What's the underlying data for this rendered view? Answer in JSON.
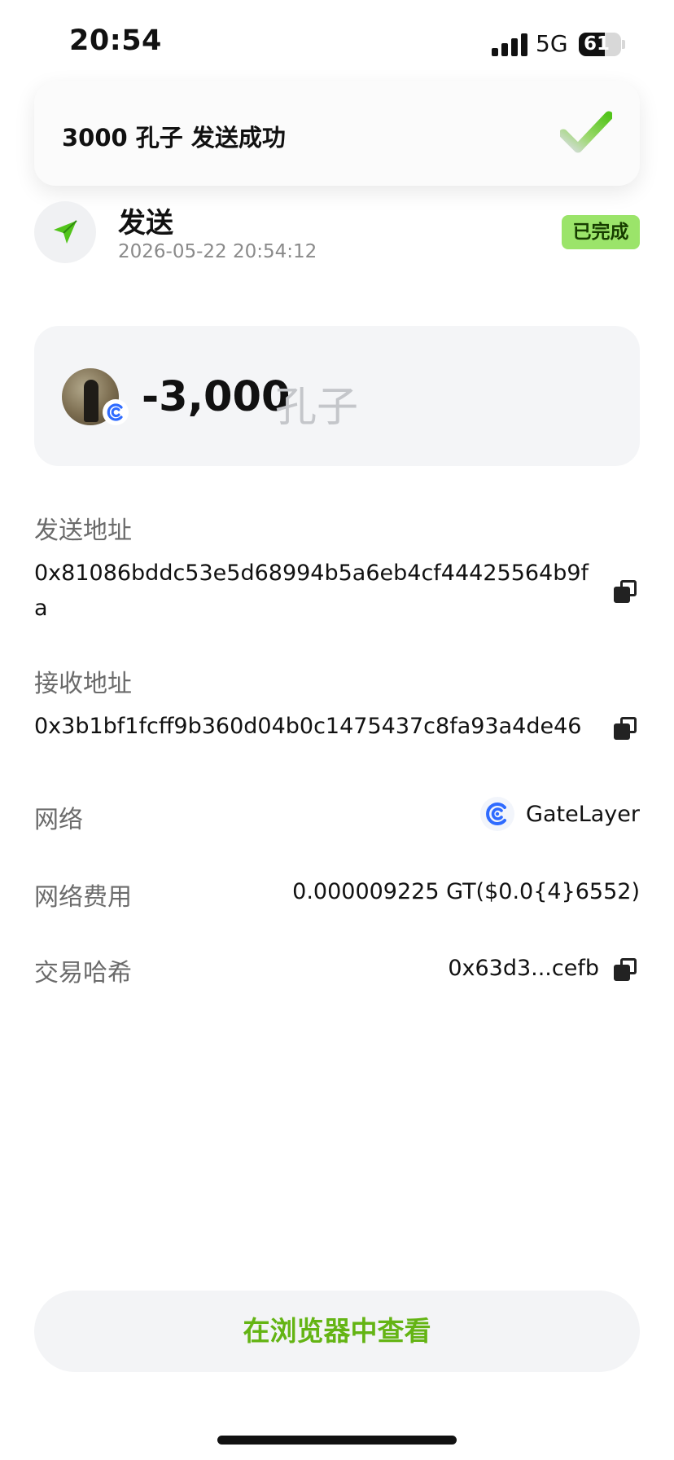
{
  "status_bar": {
    "time": "20:54",
    "network": "5G",
    "battery_percent": "61",
    "battery_level": 0.61
  },
  "toast": {
    "message": "3000 孔子 发送成功"
  },
  "header": {
    "title": "发送",
    "timestamp": "2026-05-22 20:54:12",
    "status": "已完成"
  },
  "amount": {
    "value": "-3,000",
    "unit": "孔子"
  },
  "details": {
    "from_label": "发送地址",
    "from_address": "0x81086bddc53e5d68994b5a6eb4cf44425564b9fa",
    "to_label": "接收地址",
    "to_address": "0x3b1bf1fcff9b360d04b0c1475437c8fa93a4de46",
    "network_label": "网络",
    "network_value": "GateLayer",
    "fee_label": "网络费用",
    "fee_value": "0.000009225 GT($0.0{4}6552)",
    "hash_label": "交易哈希",
    "hash_value": "0x63d3...cefb"
  },
  "actions": {
    "explorer_button": "在浏览器中查看"
  },
  "colors": {
    "accent_green": "#64b414",
    "badge_green": "#9be46a",
    "send_icon_green": "#52c41a",
    "chain_blue": "#2f6bff"
  },
  "icons": {
    "toast": "checkmark-icon",
    "header": "send-arrow-icon",
    "copy": "copy-icon",
    "network": "gatelayer-logo-icon"
  }
}
